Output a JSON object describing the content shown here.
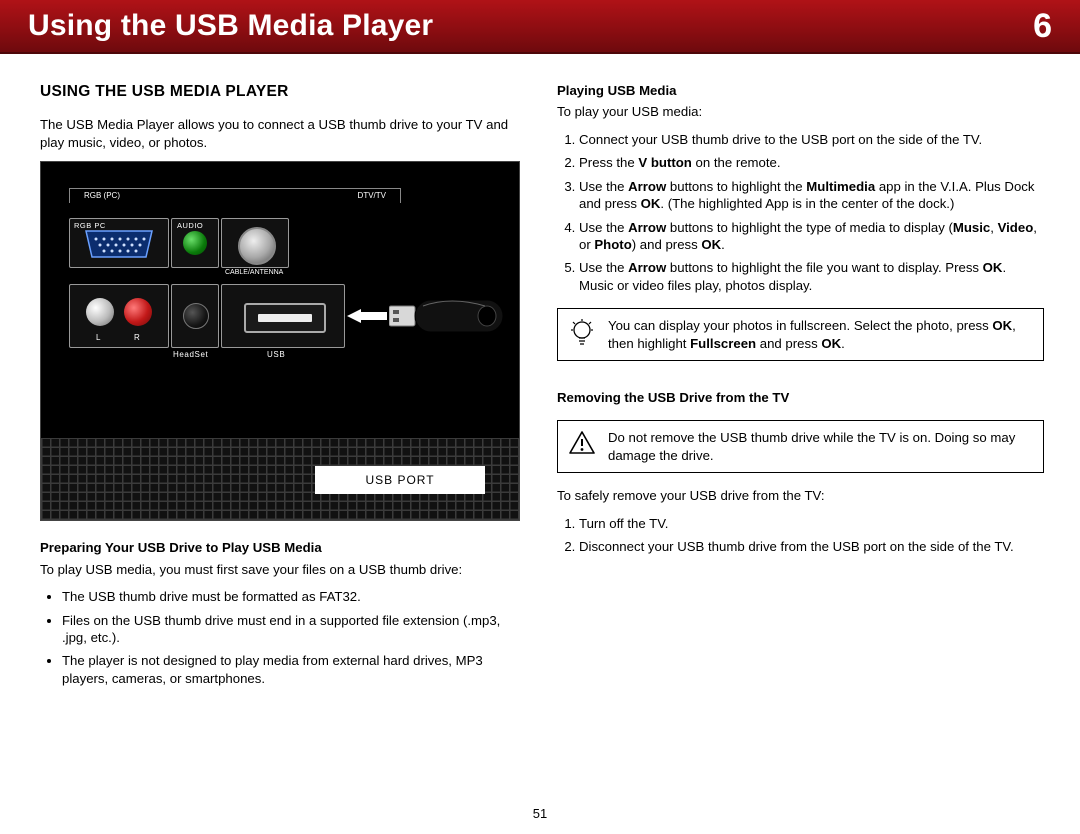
{
  "banner": {
    "title": "Using the USB Media Player",
    "chapter": "6"
  },
  "page_number": "51",
  "left": {
    "heading": "USING THE USB MEDIA PLAYER",
    "intro": "The USB Media Player allows you to connect a USB thumb drive to your TV and play music, video, or photos.",
    "diagram": {
      "rgb_pc_top": "RGB (PC)",
      "dtv_tv_top": "DTV/TV",
      "rgb_pc": "RGB PC",
      "audio": "AUDIO",
      "cable_antenna": "CABLE/ANTENNA",
      "l": "L",
      "r": "R",
      "headset": "HeadSet",
      "usb": "USB",
      "usb_port_label": "USB PORT"
    },
    "prep_head": "Preparing Your USB Drive to Play USB Media",
    "prep_intro": "To play USB media, you must first save your files on a USB thumb drive:",
    "prep_items": [
      "The USB thumb drive must be formatted as FAT32.",
      "Files on the USB thumb drive must end in a supported file extension (.mp3, .jpg, etc.).",
      "The player is not designed to play media from external hard drives, MP3 players, cameras, or smartphones."
    ]
  },
  "right": {
    "play_head": "Playing USB Media",
    "play_intro": "To play your USB media:",
    "tip_text_a": "You can display your photos in fullscreen. Select the photo, press ",
    "tip_ok1": "OK",
    "tip_text_b": ", then highlight ",
    "tip_fs": "Fullscreen",
    "tip_text_c": " and press ",
    "tip_ok2": "OK",
    "tip_text_d": ".",
    "remove_head": "Removing the USB Drive from the TV",
    "warn_text": "Do not remove the USB thumb drive while the TV is on. Doing so may damage the drive.",
    "remove_intro": "To safely remove your USB drive from the TV:",
    "remove_steps": [
      "Turn off the TV.",
      "Disconnect your USB thumb drive from the USB port on the side of the TV."
    ],
    "steps": {
      "s1": "Connect your USB thumb drive to the USB port on the side of the TV.",
      "s2a": "Press the ",
      "s2b": "V button",
      "s2c": " on the remote.",
      "s3a": "Use the ",
      "s3b": "Arrow",
      "s3c": " buttons to highlight the ",
      "s3d": "Multimedia",
      "s3e": " app in the V.I.A. Plus Dock and press ",
      "s3f": "OK",
      "s3g": ". (The highlighted App is in the center of the dock.)",
      "s4a": "Use the ",
      "s4b": "Arrow",
      "s4c": " buttons to highlight the type of media to display (",
      "s4d": "Music",
      "s4e": ", ",
      "s4f": "Video",
      "s4g": ", or ",
      "s4h": "Photo",
      "s4i": ") and press ",
      "s4j": "OK",
      "s4k": ".",
      "s5a": "Use the ",
      "s5b": "Arrow",
      "s5c": " buttons to highlight the file you want to display. Press ",
      "s5d": "OK",
      "s5e": ". Music or video files play, photos display."
    }
  }
}
